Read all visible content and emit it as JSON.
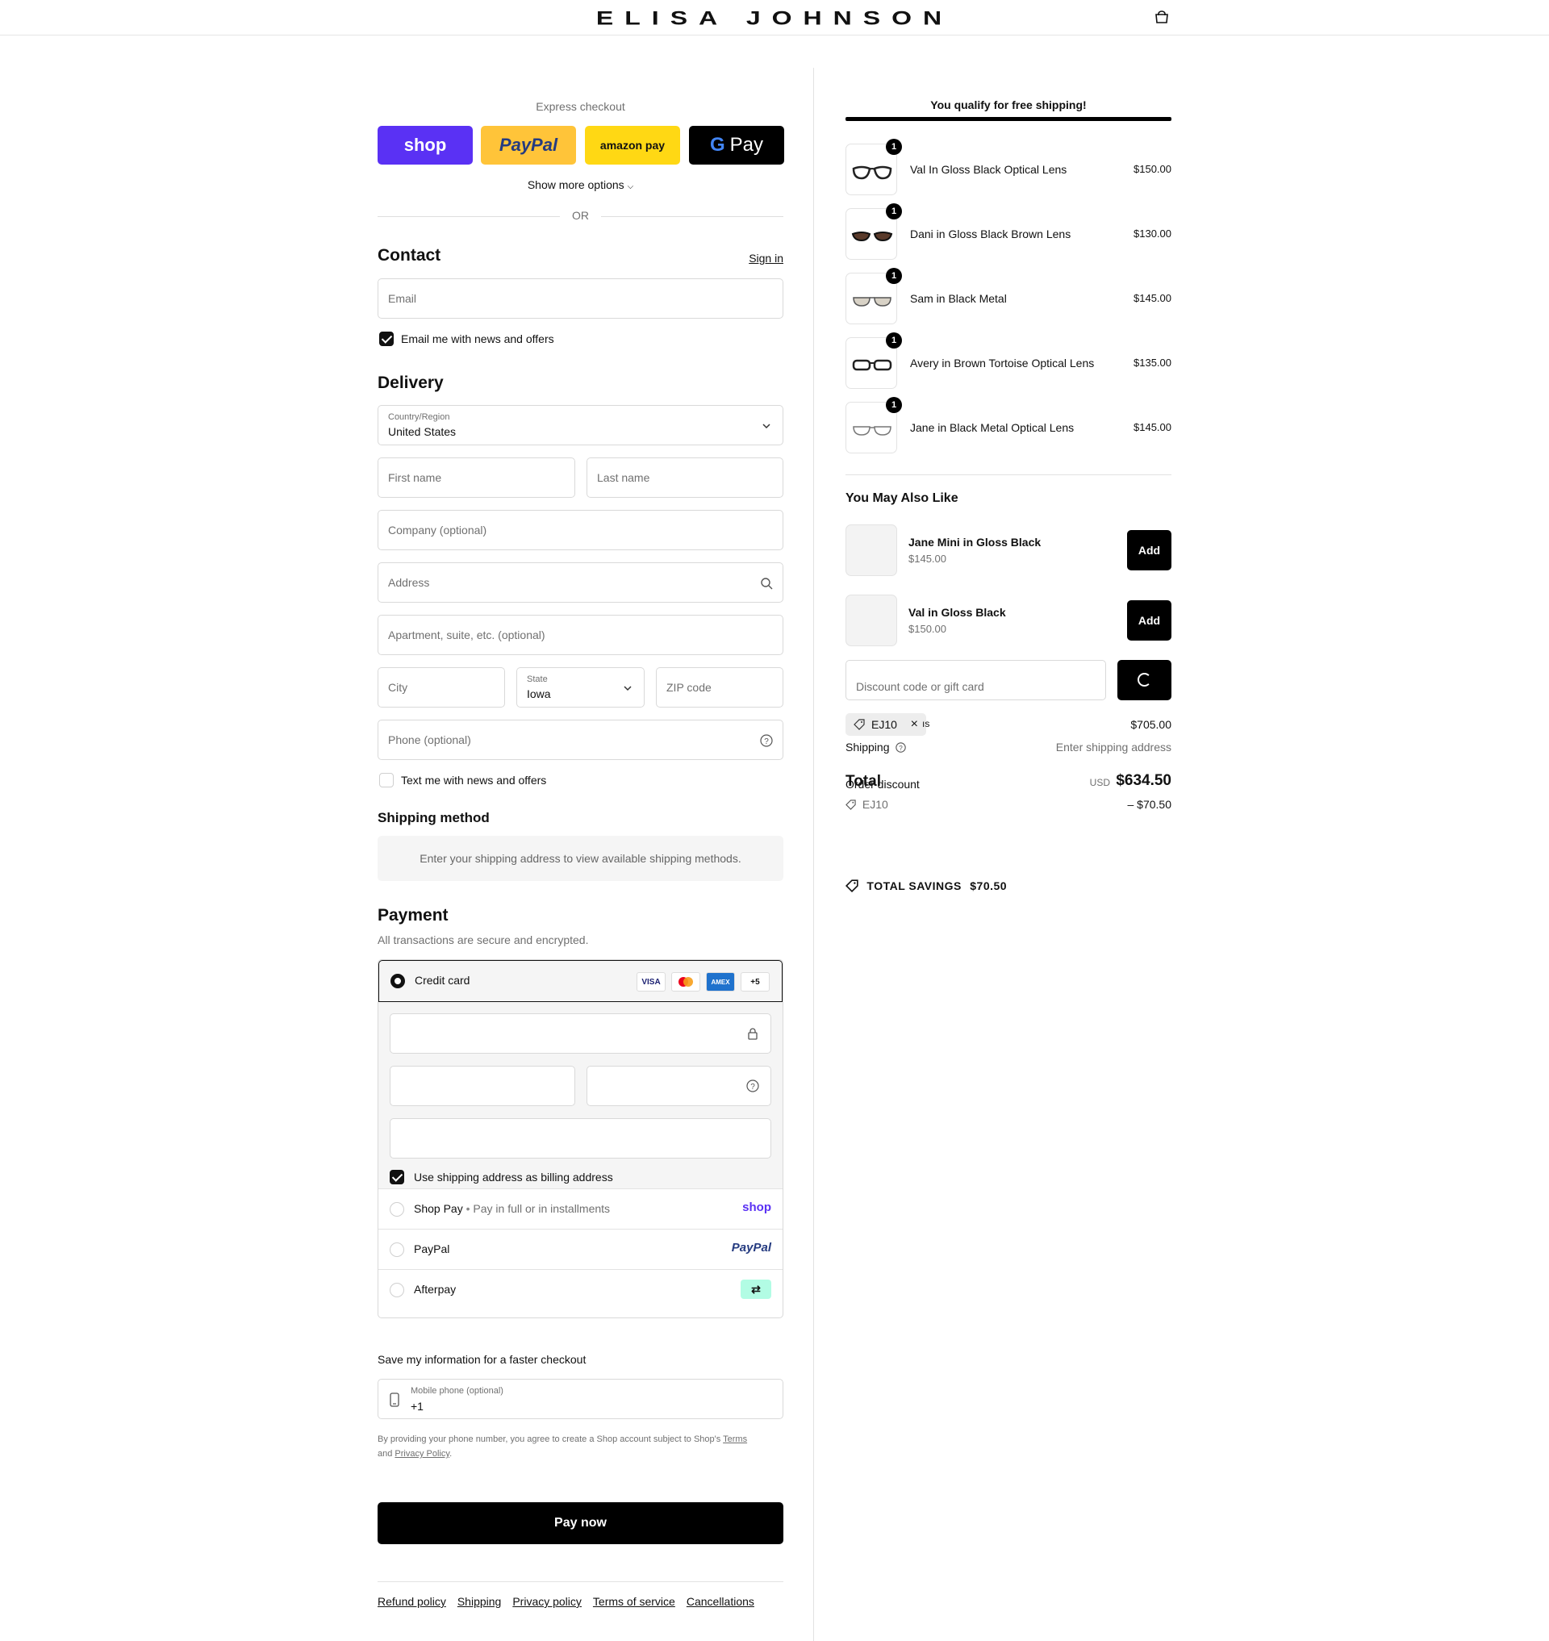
{
  "header": {
    "brand": "ELISA JOHNSON",
    "cart_icon": "bag-icon"
  },
  "express": {
    "title": "Express checkout",
    "buttons": [
      "shop",
      "PayPal",
      "amazon pay",
      "Pay"
    ],
    "show_more": "Show more options",
    "or": "OR"
  },
  "contact": {
    "title": "Contact",
    "sign_in": "Sign in",
    "email_placeholder": "Email",
    "news_checkbox": "Email me with news and offers",
    "news_checked": true
  },
  "delivery": {
    "title": "Delivery",
    "country_label": "Country/Region",
    "country_value": "United States",
    "first_name": "First name",
    "last_name": "Last name",
    "company": "Company (optional)",
    "address": "Address",
    "apartment": "Apartment, suite, etc. (optional)",
    "city": "City",
    "state_label": "State",
    "state_value": "Iowa",
    "zip": "ZIP code",
    "phone": "Phone (optional)",
    "text_checkbox": "Text me with news and offers",
    "text_checked": false
  },
  "shipping_method": {
    "title": "Shipping method",
    "message": "Enter your shipping address to view available shipping methods."
  },
  "payment": {
    "title": "Payment",
    "subtitle": "All transactions are secure and encrypted.",
    "credit_card": "Credit card",
    "card_brands": [
      "VISA",
      "MC",
      "AMEX",
      "+5"
    ],
    "billing_checkbox": "Use shipping address as billing address",
    "billing_checked": true,
    "methods": [
      {
        "name": "Shop Pay",
        "note": "Pay in full or in installments",
        "logo": "shop"
      },
      {
        "name": "PayPal",
        "note": "",
        "logo": "PayPal"
      },
      {
        "name": "Afterpay",
        "note": "",
        "logo": "afterpay-icon"
      }
    ]
  },
  "save_info": {
    "title": "Save my information for a faster checkout",
    "phone_label": "Mobile phone (optional)",
    "phone_value": "+1",
    "legal_prefix": "By providing your phone number, you agree to create a Shop account subject to Shop's",
    "terms": "Terms",
    "and": "and",
    "privacy": "Privacy Policy",
    "period": "."
  },
  "pay_now": "Pay now",
  "footer": [
    "Refund policy",
    "Shipping",
    "Privacy policy",
    "Terms of service",
    "Cancellations"
  ],
  "summary": {
    "free_shipping": "You qualify for free shipping!",
    "free_shipping_progress": 1.0,
    "items": [
      {
        "name": "Val In Gloss Black Optical Lens",
        "price": "$150.00",
        "qty": "1"
      },
      {
        "name": "Dani in Gloss Black Brown Lens",
        "price": "$130.00",
        "qty": "1"
      },
      {
        "name": "Sam in Black Metal",
        "price": "$145.00",
        "qty": "1"
      },
      {
        "name": "Avery in Brown Tortoise Optical Lens",
        "price": "$135.00",
        "qty": "1"
      },
      {
        "name": "Jane in Black Metal Optical Lens",
        "price": "$145.00",
        "qty": "1"
      }
    ],
    "also_like_title": "You May Also Like",
    "recommendations": [
      {
        "name": "Jane Mini in Gloss Black",
        "price": "$145.00",
        "button": "Add"
      },
      {
        "name": "Val in Gloss Black",
        "price": "$150.00",
        "button": "Add"
      }
    ],
    "discount_placeholder": "Discount code or gift card",
    "applied_code": "EJ10",
    "subtotal_tail": "ıs",
    "subtotal": "$705.00",
    "shipping_label": "Shipping",
    "shipping_value": "Enter shipping address",
    "total_label": "Total",
    "order_discount_label": "Order discount",
    "currency": "USD",
    "total": "$634.50",
    "discount_code": "EJ10",
    "discount_value": "– $70.50",
    "savings_label": "TOTAL SAVINGS",
    "savings_value": "$70.50"
  }
}
